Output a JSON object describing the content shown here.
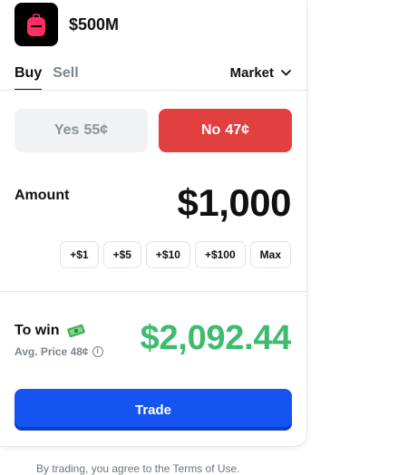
{
  "market": {
    "icon": "backpack-icon",
    "title": "$500M"
  },
  "tabs": [
    {
      "label": "Buy",
      "active": true
    },
    {
      "label": "Sell",
      "active": false
    }
  ],
  "order_type": {
    "label": "Market",
    "icon": "chevron-down-icon"
  },
  "outcomes": {
    "yes": {
      "label": "Yes",
      "price": "55¢",
      "selected": false
    },
    "no": {
      "label": "No",
      "price": "47¢",
      "selected": true
    }
  },
  "amount": {
    "label": "Amount",
    "value": "$1,000",
    "quick_add": [
      "+$1",
      "+$5",
      "+$10",
      "+$100",
      "Max"
    ]
  },
  "to_win": {
    "label": "To win",
    "icon": "money-icon",
    "avg_price": "Avg. Price 48¢",
    "info_icon": "info-icon",
    "value": "$2,092.44"
  },
  "trade_button": {
    "label": "Trade"
  },
  "terms_text": "By trading, you agree to the Terms of Use.",
  "colors": {
    "no_red": "#e23f3f",
    "win_green": "#3dbb6e",
    "trade_blue": "#1554f0"
  }
}
